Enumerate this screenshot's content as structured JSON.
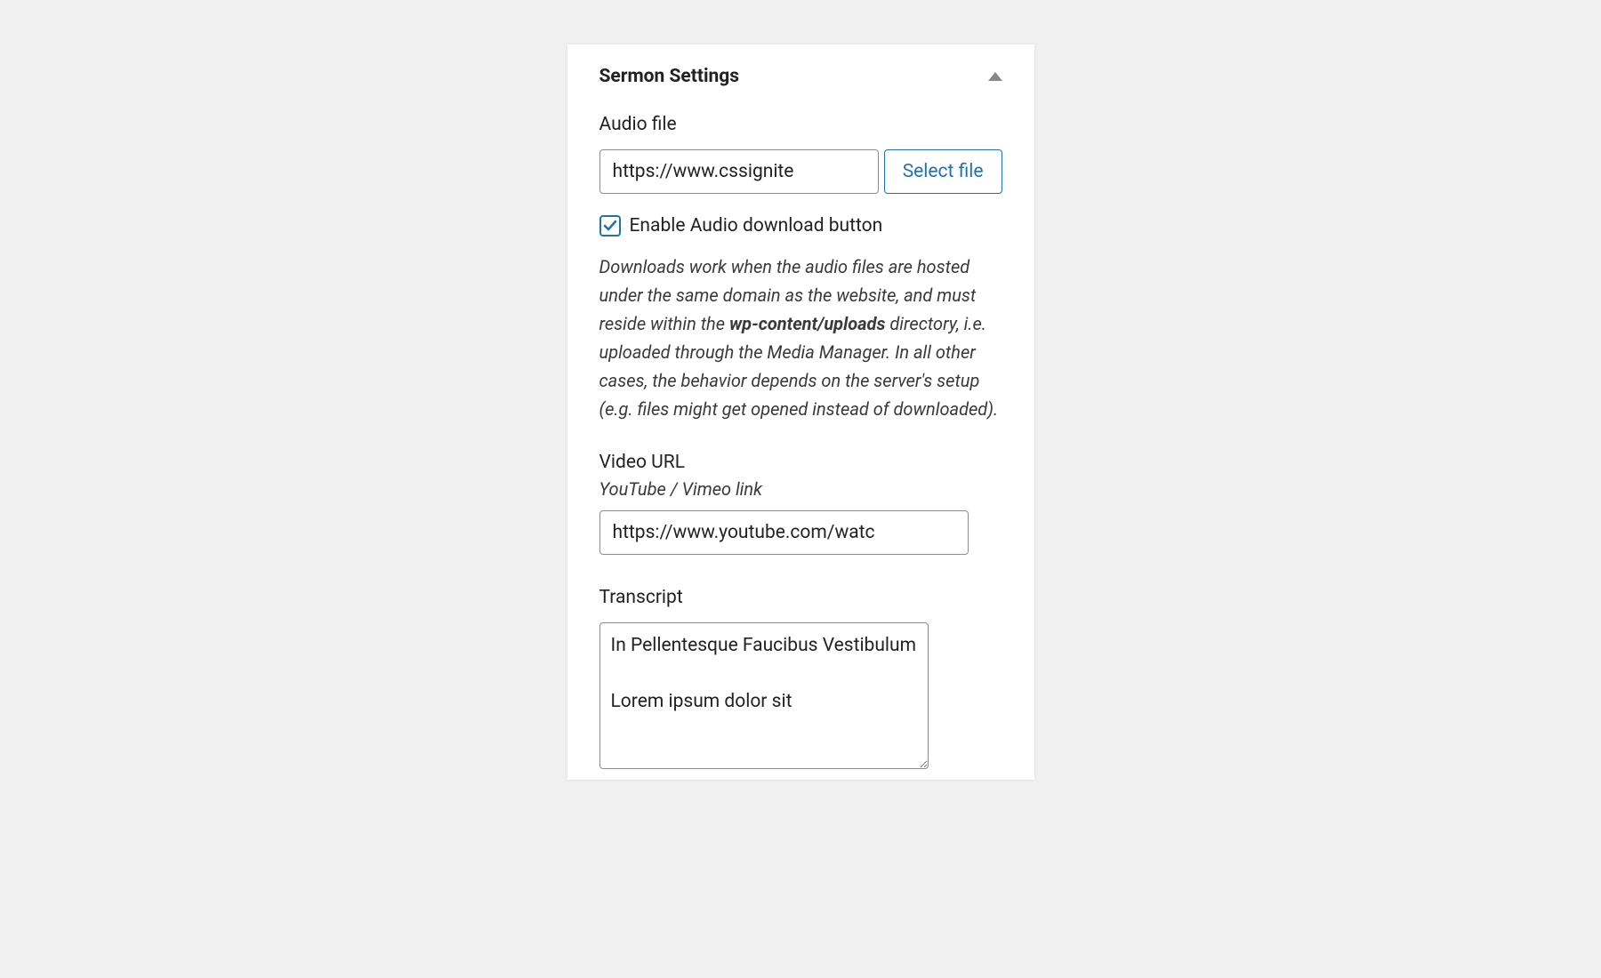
{
  "panel": {
    "title": "Sermon Settings"
  },
  "audio": {
    "label": "Audio file",
    "value": "https://www.cssignite",
    "select_button": "Select file"
  },
  "download": {
    "checkbox_label": "Enable Audio download button",
    "checked": true,
    "help_text_1": "Downloads work when the audio files are hosted under the same domain as the website, and must reside within the ",
    "help_text_bold": "wp-content/uploads",
    "help_text_2": " directory, i.e. uploaded through the Media Manager. In all other cases, the behavior depends on the server's setup (e.g. files might get opened instead of downloaded)."
  },
  "video": {
    "label": "Video URL",
    "sub_label": "YouTube / Vimeo link",
    "value": "https://www.youtube.com/watc"
  },
  "transcript": {
    "label": "Transcript",
    "value": "In Pellentesque Faucibus Vestibulum\n\nLorem ipsum dolor sit"
  }
}
